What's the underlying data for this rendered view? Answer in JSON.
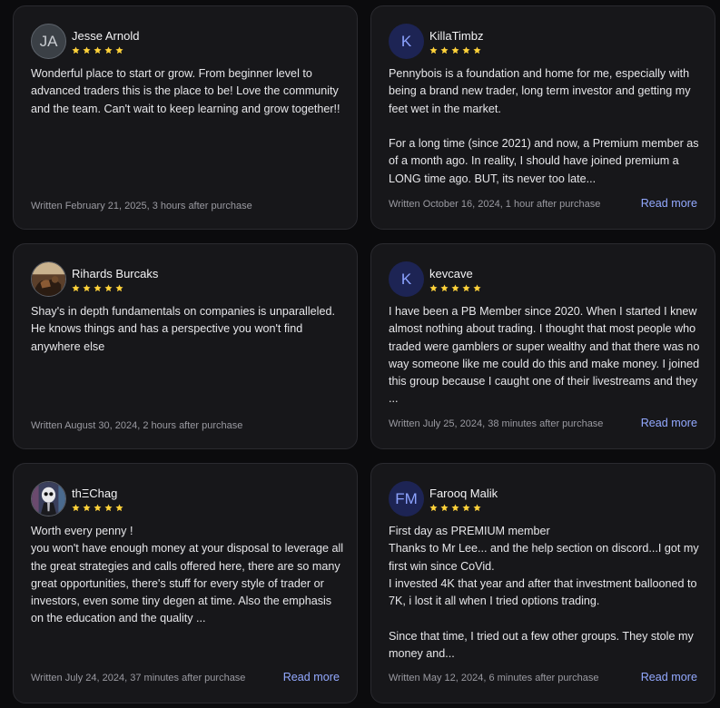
{
  "reviews": [
    {
      "initials": "JA",
      "name": "Jesse Arnold",
      "rating": 5,
      "text": "Wonderful place to start or grow. From beginner level to advanced traders this is the place to be! Love the community and the team. Can't wait to keep learning and grow together!!",
      "written": "Written February 21, 2025, 3 hours after purchase",
      "read_more": ""
    },
    {
      "initials": "K",
      "name": "KillaTimbz",
      "rating": 5,
      "text": "Pennybois is a foundation and home for me, especially with being a brand new trader, long term investor and getting my feet wet in the market.\n\nFor a long time (since 2021) and now, a Premium member as of a month ago. In reality, I should have joined premium a LONG time ago. BUT, its never too late...",
      "written": "Written October 16, 2024, 1 hour after purchase",
      "read_more": "Read more"
    },
    {
      "initials": "",
      "name": "Rihards Burcaks",
      "rating": 5,
      "text": "Shay's in depth fundamentals on companies is unparalleled. He knows things and has a perspective you won't find anywhere else",
      "written": "Written August 30, 2024, 2 hours after purchase",
      "read_more": ""
    },
    {
      "initials": "K",
      "name": "kevcave",
      "rating": 5,
      "text": "I have been a PB Member since 2020. When I started I knew almost nothing about trading. I thought that most people who traded were gamblers or super wealthy and that there was no way someone like me could do this and make money. I joined this group because I caught one of their livestreams and they ...",
      "written": "Written July 25, 2024, 38 minutes after purchase",
      "read_more": "Read more"
    },
    {
      "initials": "",
      "name": "thΞChag",
      "rating": 5,
      "text": "Worth every penny !\nyou won't have enough money at your disposal to leverage all the great strategies and calls offered here, there are so many great opportunities, there's stuff for every style of trader or investors, even some tiny degen at time. Also the emphasis on the education and the quality ...",
      "written": "Written July 24, 2024, 37 minutes after purchase",
      "read_more": "Read more"
    },
    {
      "initials": "FM",
      "name": "Farooq Malik",
      "rating": 5,
      "text": "First day as PREMIUM member\nThanks to Mr Lee... and the help section on discord...I got my first win since CoVid.\nI invested 4K that year and after that investment ballooned to 7K, i lost it all when I tried options trading.\n\nSince that time, I tried out a few other groups. They stole my money and...",
      "written": "Written May 12, 2024, 6 minutes after purchase",
      "read_more": "Read more"
    }
  ],
  "colors": {
    "star": "#ffd23a",
    "link": "#93a9ff",
    "card": "#17171a"
  },
  "icons": {
    "star": "star-icon"
  }
}
